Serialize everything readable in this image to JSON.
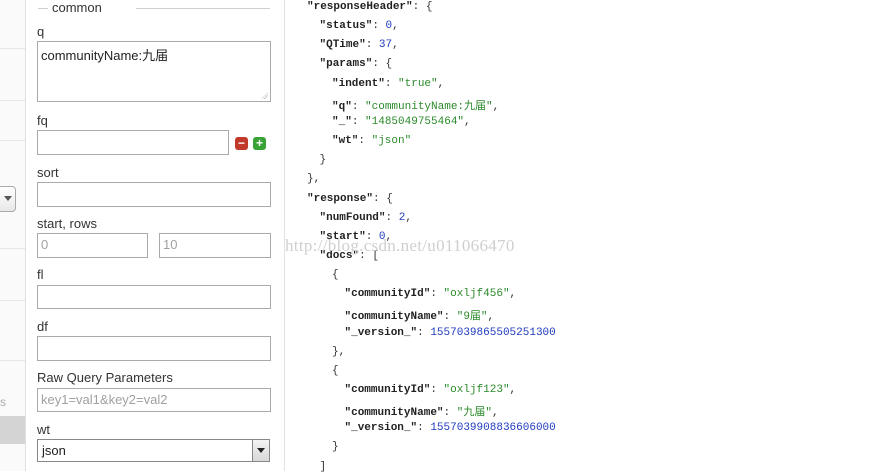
{
  "form": {
    "section_label": "common",
    "q": {
      "label": "q",
      "value": "communityName:九届"
    },
    "fq": {
      "label": "fq",
      "value": ""
    },
    "sort": {
      "label": "sort",
      "value": ""
    },
    "start_rows": {
      "label": "start, rows",
      "start_placeholder": "0",
      "rows_placeholder": "10"
    },
    "fl": {
      "label": "fl",
      "value": ""
    },
    "df": {
      "label": "df",
      "value": ""
    },
    "raw": {
      "label": "Raw Query Parameters",
      "placeholder": "key1=val1&key2=val2"
    },
    "wt": {
      "label": "wt",
      "selected": "json"
    }
  },
  "sidebar_fragment": {
    "text": "s"
  },
  "watermark": "http://blog.csdn.net/u011066470",
  "json_lines": [
    {
      "ind": 0,
      "key": "responseHeader",
      "open": "{"
    },
    {
      "ind": 1,
      "key": "status",
      "num": "0",
      "comma": ","
    },
    {
      "ind": 1,
      "key": "QTime",
      "num": "37",
      "comma": ","
    },
    {
      "ind": 1,
      "key": "params",
      "open": "{"
    },
    {
      "ind": 2,
      "key": "indent",
      "str": "\"true\"",
      "comma": ","
    },
    {
      "ind": 2,
      "key": "q",
      "str": "\"communityName:九届\"",
      "comma": ","
    },
    {
      "ind": 2,
      "key": "_",
      "str": "\"1485049755464\"",
      "comma": ","
    },
    {
      "ind": 2,
      "key": "wt",
      "str": "\"json\""
    },
    {
      "ind": 1,
      "punct": "}"
    },
    {
      "ind": 0,
      "punct": "},"
    },
    {
      "ind": 0,
      "key": "response",
      "open": "{"
    },
    {
      "ind": 1,
      "key": "numFound",
      "num": "2",
      "comma": ","
    },
    {
      "ind": 1,
      "key": "start",
      "num": "0",
      "comma": ","
    },
    {
      "ind": 1,
      "key": "docs",
      "open": "["
    },
    {
      "ind": 2,
      "punct": "{"
    },
    {
      "ind": 3,
      "key": "communityId",
      "str": "\"oxljf456\"",
      "comma": ","
    },
    {
      "ind": 3,
      "key": "communityName",
      "str": "\"9届\"",
      "comma": ","
    },
    {
      "ind": 3,
      "key": "_version_",
      "num": "1557039865505251300"
    },
    {
      "ind": 2,
      "punct": "},"
    },
    {
      "ind": 2,
      "punct": "{"
    },
    {
      "ind": 3,
      "key": "communityId",
      "str": "\"oxljf123\"",
      "comma": ","
    },
    {
      "ind": 3,
      "key": "communityName",
      "str": "\"九届\"",
      "comma": ","
    },
    {
      "ind": 3,
      "key": "_version_",
      "num": "1557039908836606000"
    },
    {
      "ind": 2,
      "punct": "}"
    },
    {
      "ind": 1,
      "punct": "]"
    }
  ],
  "colors": {
    "string": "#2b8a2b",
    "number": "#1f3bbf",
    "remove_button": "#c0392b",
    "add_button": "#3aa335"
  }
}
